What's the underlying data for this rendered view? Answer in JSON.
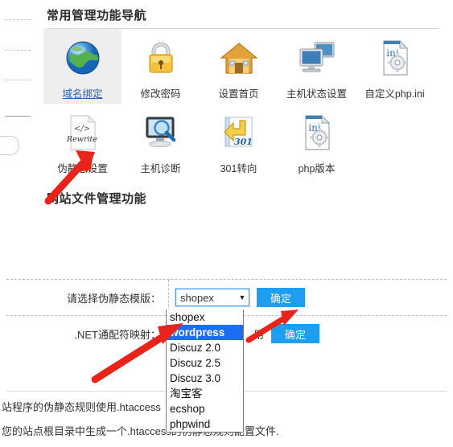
{
  "sections": {
    "nav_title": "常用管理功能导航",
    "file_title": "网站文件管理功能"
  },
  "icons_row1": [
    {
      "label": "域名绑定",
      "icon": "globe-icon",
      "selected": true
    },
    {
      "label": "修改密码",
      "icon": "padlock-icon",
      "selected": false
    },
    {
      "label": "设置首页",
      "icon": "house-icon",
      "selected": false
    },
    {
      "label": "主机状态设置",
      "icon": "monitors-icon",
      "selected": false
    },
    {
      "label": "自定义php.ini",
      "icon": "ini-file-gear-icon",
      "selected": false
    }
  ],
  "icons_row2": [
    {
      "label": "伪静态设置",
      "icon": "rewrite-file-icon",
      "selected": false
    },
    {
      "label": "主机诊断",
      "icon": "monitor-magnifier-icon",
      "selected": false
    },
    {
      "label": "301转向",
      "icon": "redirect-301-icon",
      "selected": false
    },
    {
      "label": "php版本",
      "icon": "ini-file-gear-icon",
      "selected": false
    }
  ],
  "form": {
    "row1": {
      "label": "请选择伪静态模版：",
      "select_value": "shopex",
      "button": "确定"
    },
    "row2": {
      "label": ".NET通配符映射：",
      "tail_text": "用",
      "button": "确定"
    }
  },
  "dropdown": {
    "options": [
      "shopex",
      "wordpress",
      "Discuz 2.0",
      "Discuz 2.5",
      "Discuz 3.0",
      "淘宝客",
      "ecshop",
      "phpwind"
    ],
    "selected": "wordpress"
  },
  "notes": [
    "站程序的伪静态规则使用.htaccess",
    "您的站点根目录中生成一个.htaccess的伪静态规则配置文件."
  ],
  "colors": {
    "accent_blue": "#1e9ef0",
    "highlight_blue": "#1b6ef3",
    "link_blue": "#2a5db0",
    "arrow_red": "#e8241a",
    "selected_bg": "#eeeeee"
  }
}
